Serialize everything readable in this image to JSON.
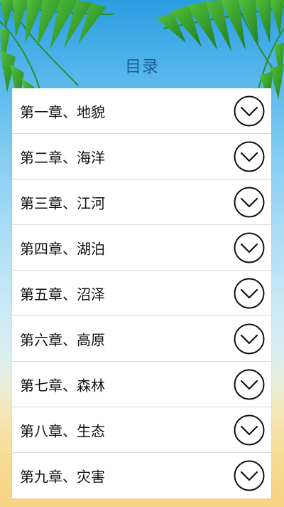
{
  "header": {
    "title": "目录"
  },
  "chapters": [
    {
      "label": "第一章、地貌"
    },
    {
      "label": "第二章、海洋"
    },
    {
      "label": "第三章、江河"
    },
    {
      "label": "第四章、湖泊"
    },
    {
      "label": "第五章、沼泽"
    },
    {
      "label": "第六章、高原"
    },
    {
      "label": "第七章、森林"
    },
    {
      "label": "第八章、生态"
    },
    {
      "label": "第九章、灾害"
    }
  ],
  "icons": {
    "row_action": "chevron-down-circle-icon",
    "background": "palm-leaves"
  },
  "colors": {
    "title": "#1f5f93",
    "sky_top": "#2a9de0",
    "sand": "#f6d483",
    "leaf": "#2f9a2a"
  }
}
